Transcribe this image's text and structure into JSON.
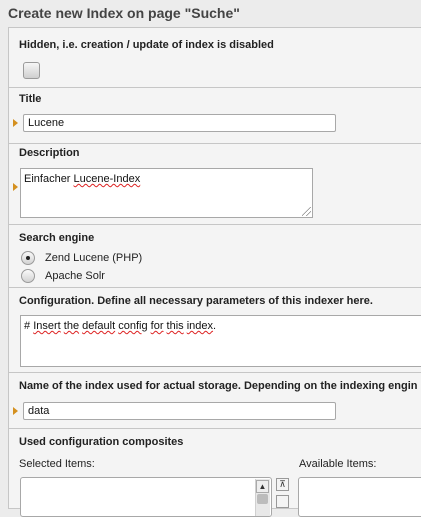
{
  "page": {
    "heading": "Create new Index on page \"Suche\""
  },
  "hidden": {
    "label": "Hidden, i.e. creation / update of index is disabled"
  },
  "title": {
    "label": "Title",
    "value": "Lucene"
  },
  "description": {
    "label": "Description",
    "value_word1": "Einfacher",
    "value_word2": "Lucene-Index"
  },
  "search_engine": {
    "label": "Search engine",
    "options": [
      "Zend Lucene (PHP)",
      "Apache Solr"
    ],
    "selected": "Zend Lucene (PHP)"
  },
  "configuration": {
    "label": "Configuration. Define all necessary parameters of this indexer here.",
    "value_hash": "#",
    "value_w1": "Insert",
    "value_w2": "the",
    "value_w3": "default",
    "value_w4": "config",
    "value_w5": "for",
    "value_w6": "this",
    "value_w7": "index",
    "value_end": "."
  },
  "storage": {
    "label": "Name of the index used for actual storage. Depending on the indexing engin",
    "value": "data"
  },
  "composites": {
    "label": "Used configuration composites",
    "selected_label": "Selected Items:",
    "available_label": "Available Items:"
  },
  "icons": {
    "marker": "required-marker-icon",
    "up": "scroll-up-icon",
    "top": "move-to-top-icon"
  },
  "colors": {
    "marker": "#d4901f",
    "spellcheck": "#dd2222"
  }
}
